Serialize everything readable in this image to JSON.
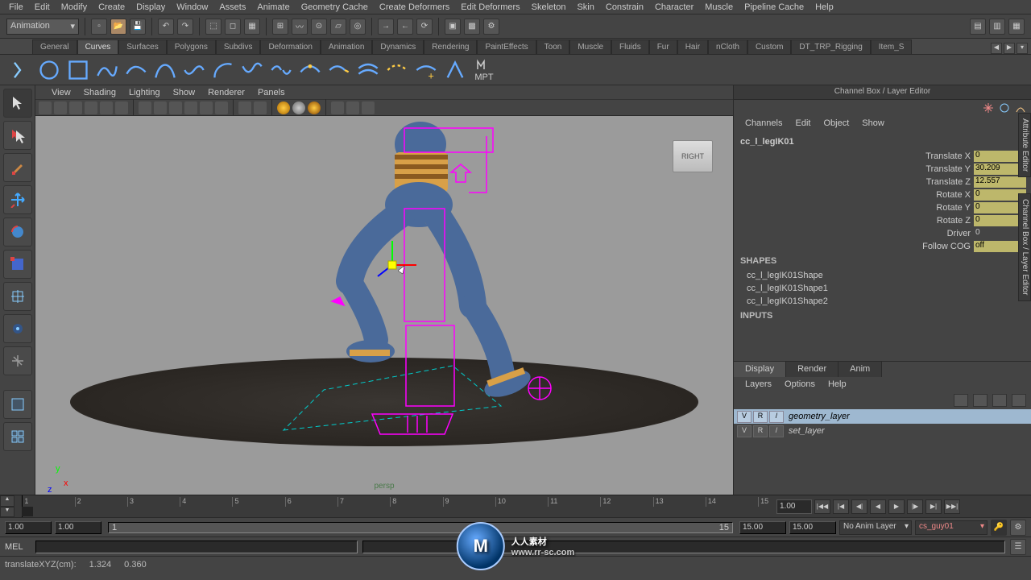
{
  "menubar": [
    "File",
    "Edit",
    "Modify",
    "Create",
    "Display",
    "Window",
    "Assets",
    "Animate",
    "Geometry Cache",
    "Create Deformers",
    "Edit Deformers",
    "Skeleton",
    "Skin",
    "Constrain",
    "Character",
    "Muscle",
    "Pipeline Cache",
    "Help"
  ],
  "mode": "Animation",
  "shelf_tabs": [
    "General",
    "Curves",
    "Surfaces",
    "Polygons",
    "Subdivs",
    "Deformation",
    "Animation",
    "Dynamics",
    "Rendering",
    "PaintEffects",
    "Toon",
    "Muscle",
    "Fluids",
    "Fur",
    "Hair",
    "nCloth",
    "Custom",
    "DT_TRP_Rigging",
    "Item_S"
  ],
  "shelf_active": "Curves",
  "shelf_mpt": "MPT",
  "viewport_menus": [
    "View",
    "Shading",
    "Lighting",
    "Show",
    "Renderer",
    "Panels"
  ],
  "viewcube": "RIGHT",
  "persp": "persp",
  "right_panel": {
    "title": "Channel Box / Layer Editor",
    "menus": [
      "Channels",
      "Edit",
      "Object",
      "Show"
    ],
    "object": "cc_l_legIK01",
    "attrs": [
      {
        "label": "Translate X",
        "value": "0",
        "editable": true
      },
      {
        "label": "Translate Y",
        "value": "30.209",
        "editable": true
      },
      {
        "label": "Translate Z",
        "value": "12.557",
        "editable": true
      },
      {
        "label": "Rotate X",
        "value": "0",
        "editable": true
      },
      {
        "label": "Rotate Y",
        "value": "0",
        "editable": true
      },
      {
        "label": "Rotate Z",
        "value": "0",
        "editable": true
      },
      {
        "label": "Driver",
        "value": "0",
        "editable": false
      },
      {
        "label": "Follow COG",
        "value": "off",
        "editable": true
      }
    ],
    "shapes_label": "SHAPES",
    "shapes": [
      "cc_l_legIK01Shape",
      "cc_l_legIK01Shape1",
      "cc_l_legIK01Shape2"
    ],
    "inputs_label": "INPUTS",
    "layer_tabs": [
      "Display",
      "Render",
      "Anim"
    ],
    "layer_active": "Display",
    "layer_menus": [
      "Layers",
      "Options",
      "Help"
    ],
    "layers": [
      {
        "v": "V",
        "r": "R",
        "p": "/",
        "name": "geometry_layer",
        "sel": true
      },
      {
        "v": "V",
        "r": "R",
        "p": "/",
        "name": "set_layer",
        "sel": false
      }
    ]
  },
  "side_tabs": [
    "Attribute Editor",
    "Channel Box / Layer Editor"
  ],
  "timeline": {
    "ticks": [
      "1",
      "2",
      "3",
      "4",
      "5",
      "6",
      "7",
      "8",
      "9",
      "10",
      "11",
      "12",
      "13",
      "14",
      "15"
    ],
    "cursor_frame": "1",
    "end_field": "1.00"
  },
  "range": {
    "start_out": "1.00",
    "start_in": "1.00",
    "slider_start": "1",
    "cur": "15",
    "end_in": "15.00",
    "end_out": "15.00",
    "anim_layer": "No Anim Layer",
    "char": "cs_guy01"
  },
  "cmd_label": "MEL",
  "status": {
    "label": "translateXYZ(cm):",
    "x": "1.324",
    "y": "0.360"
  },
  "watermark": {
    "main": "人人素材",
    "sub": "www.rr-sc.com",
    "logo": "M"
  }
}
